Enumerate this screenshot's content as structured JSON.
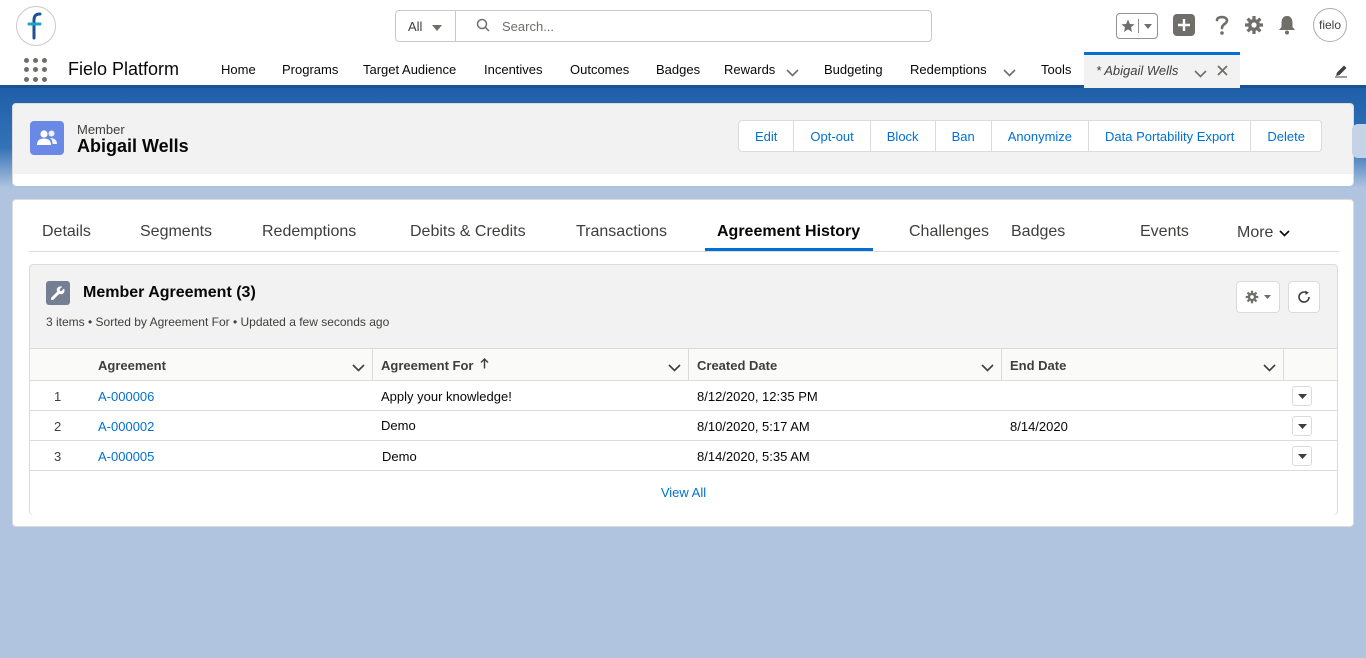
{
  "header": {
    "logo_icon": "fielo-logo-icon",
    "search": {
      "scope": "All",
      "placeholder": "Search..."
    },
    "avatar_text": "fielo"
  },
  "nav": {
    "app_name": "Fielo Platform",
    "items": [
      {
        "label": "Home"
      },
      {
        "label": "Programs"
      },
      {
        "label": "Target Audience"
      },
      {
        "label": "Incentives"
      },
      {
        "label": "Outcomes"
      },
      {
        "label": "Badges"
      },
      {
        "label": "Rewards",
        "has_menu": true
      },
      {
        "label": "Budgeting"
      },
      {
        "label": "Redemptions",
        "has_menu": true
      },
      {
        "label": "Tools"
      }
    ],
    "active_tab": {
      "label": "* Abigail Wells"
    }
  },
  "record": {
    "object_type": "Member",
    "name": "Abigail Wells",
    "actions": [
      "Edit",
      "Opt-out",
      "Block",
      "Ban",
      "Anonymize",
      "Data Portability Export",
      "Delete"
    ]
  },
  "tabs": {
    "items": [
      "Details",
      "Segments",
      "Redemptions",
      "Debits & Credits",
      "Transactions",
      "Agreement History",
      "Challenges",
      "Badges",
      "Events"
    ],
    "active": "Agreement History",
    "more_label": "More"
  },
  "related_list": {
    "title": "Member Agreement (3)",
    "meta": "3 items • Sorted by Agreement For • Updated a few seconds ago",
    "columns": [
      "Agreement",
      "Agreement For",
      "Created Date",
      "End Date"
    ],
    "sorted_column": "Agreement For",
    "rows": [
      {
        "num": "1",
        "agreement": "A-000006",
        "agreement_for": "Apply your knowledge!",
        "created": "8/12/2020, 12:35 PM",
        "end": ""
      },
      {
        "num": "2",
        "agreement": "A-000002",
        "agreement_for": "Demo",
        "created": "8/10/2020, 5:17 AM",
        "end": "8/14/2020"
      },
      {
        "num": "3",
        "agreement": "A-000005",
        "agreement_for": "Demo",
        "created": "8/14/2020, 5:35 AM",
        "end": ""
      }
    ],
    "view_all": "View All"
  },
  "colors": {
    "brand": "#0070d2",
    "nav_accent": "#1b5297",
    "member_icon": "#6a89e6"
  }
}
